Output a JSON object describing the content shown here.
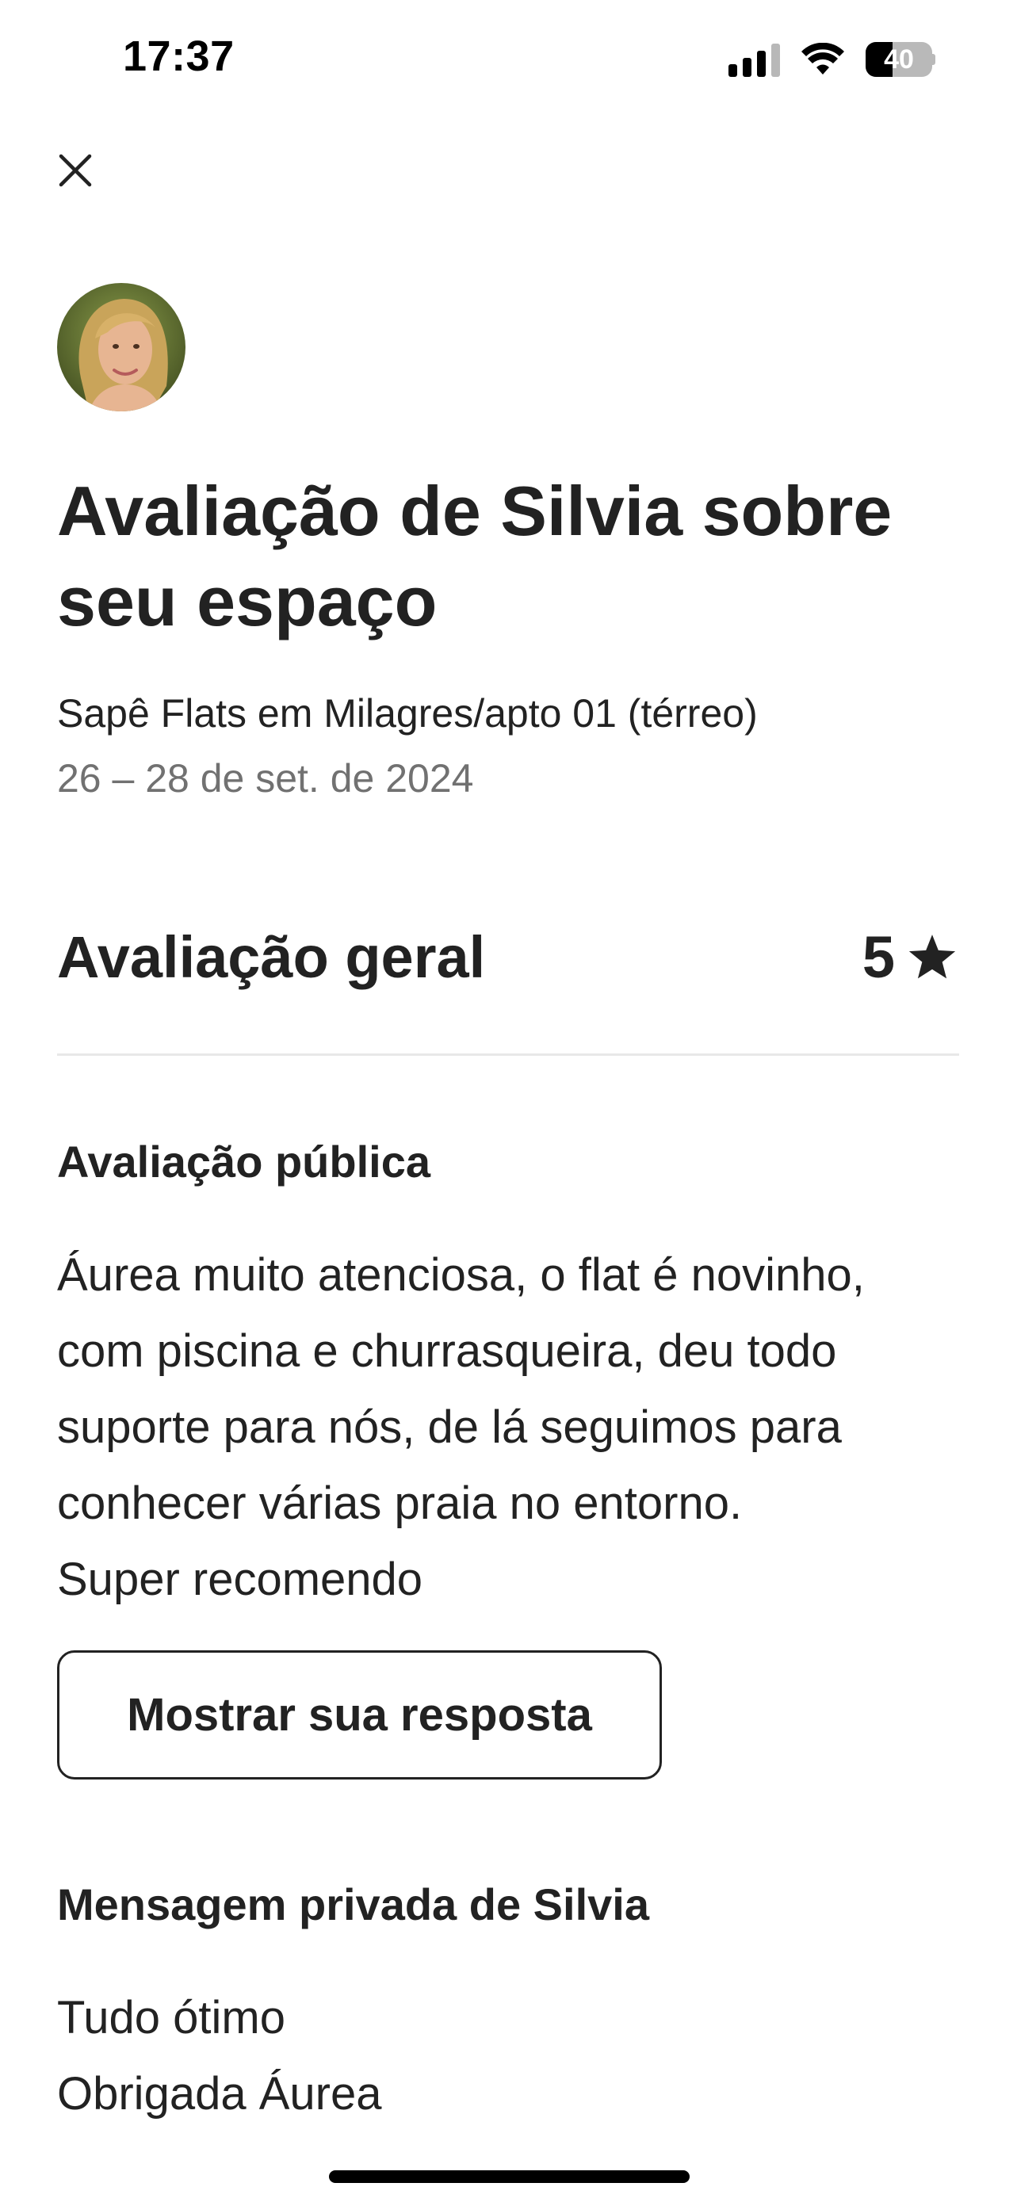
{
  "status_bar": {
    "time": "17:37",
    "battery_level": "40",
    "battery_fill_percent": 40
  },
  "icons": {
    "close": "close-icon",
    "star": "star-icon",
    "signal": "cellular-signal-icon",
    "wifi": "wifi-icon",
    "battery": "battery-icon"
  },
  "review": {
    "title": "Avaliação de Silvia sobre seu espaço",
    "listing": "Sapê Flats em Milagres/apto 01 (térreo)",
    "dates": "26 – 28 de set. de 2024",
    "overall_label": "Avaliação geral",
    "overall_score": "5",
    "public_heading": "Avaliação pública",
    "public_text": "Áurea muito atenciosa, o flat é novinho,\ncom piscina e churrasqueira, deu todo\nsuporte para nós, de lá seguimos para\nconhecer várias praia no entorno.\nSuper recomendo",
    "reply_button": "Mostrar sua resposta",
    "private_heading": "Mensagem privada de Silvia",
    "private_text": "Tudo ótimo\nObrigada Áurea"
  },
  "colors": {
    "text_primary": "#222222",
    "text_secondary": "#717171",
    "divider": "#e8e8e8"
  }
}
